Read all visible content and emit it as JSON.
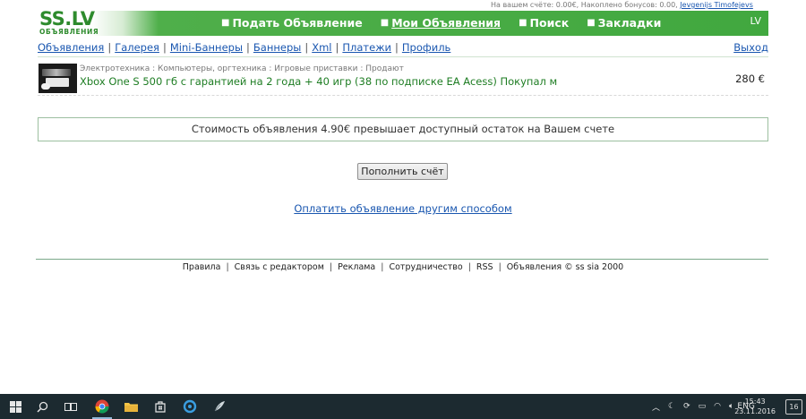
{
  "account_bar": {
    "prefix": "На вашем счёте: 0.00€, Накоплено бонусов: 0.00,",
    "user": "Jevgenijs Timofejevs"
  },
  "header": {
    "logo": "SS.LV",
    "logo_sub": "ОБЪЯВЛЕНИЯ",
    "nav": [
      {
        "label": "Подать Объявление",
        "active": false
      },
      {
        "label": "Мои Объявления",
        "active": true
      },
      {
        "label": "Поиск",
        "active": false
      },
      {
        "label": "Закладки",
        "active": false
      }
    ],
    "lang": "LV"
  },
  "subnav": {
    "items": [
      "Объявления",
      "Галерея",
      "Mini-Баннеры",
      "Баннеры",
      "Xml",
      "Платежи",
      "Профиль"
    ],
    "separator": "|",
    "logout": "Выход"
  },
  "ad": {
    "category": "Электротехника : Компьютеры, оргтехника : Игровые приставки : Продают",
    "title": "Xbox One S 500 гб с гарантией на 2 года + 40 игр (38 по подписке EA Acess) Покупал м",
    "price": "280 €"
  },
  "notice": "Стоимость объявления 4.90€ превышает доступный остаток на Вашем счете",
  "topup_button": "Пополнить счёт",
  "pay_other_link": "Оплатить объявление другим способом",
  "footer": {
    "items": [
      "Правила",
      "Связь с редактором",
      "Реклама",
      "Сотрудничество",
      "RSS",
      "Объявления © ss sia 2000"
    ],
    "separator": "|"
  },
  "taskbar": {
    "icons": [
      "windows-start",
      "search",
      "task-view",
      "chrome",
      "file-explorer",
      "store",
      "app-circle",
      "app-feather"
    ],
    "lang": "ENG",
    "time": "15:43",
    "date": "23.11.2016",
    "notification_count": "16"
  }
}
